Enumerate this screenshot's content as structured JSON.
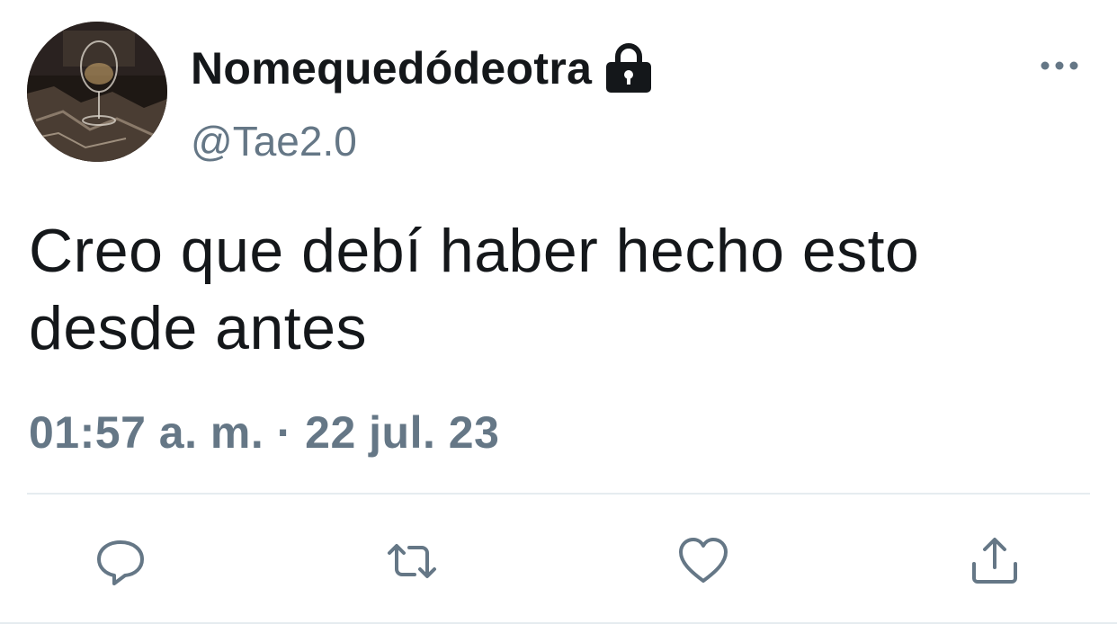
{
  "tweet": {
    "display_name": "Nomequedódeotra",
    "handle": "@Tae2.0",
    "text": "Creo que debí haber hecho esto desde antes",
    "timestamp": "01:57 a. m. · 22 jul. 23",
    "protected": true
  },
  "icons": {
    "lock": "lock-icon",
    "more": "more-horizontal-icon",
    "reply": "reply-icon",
    "retweet": "retweet-icon",
    "like": "heart-icon",
    "share": "share-icon"
  },
  "colors": {
    "text_primary": "#14171a",
    "text_secondary": "#657786",
    "divider": "#e6ecf0",
    "background": "#ffffff"
  }
}
